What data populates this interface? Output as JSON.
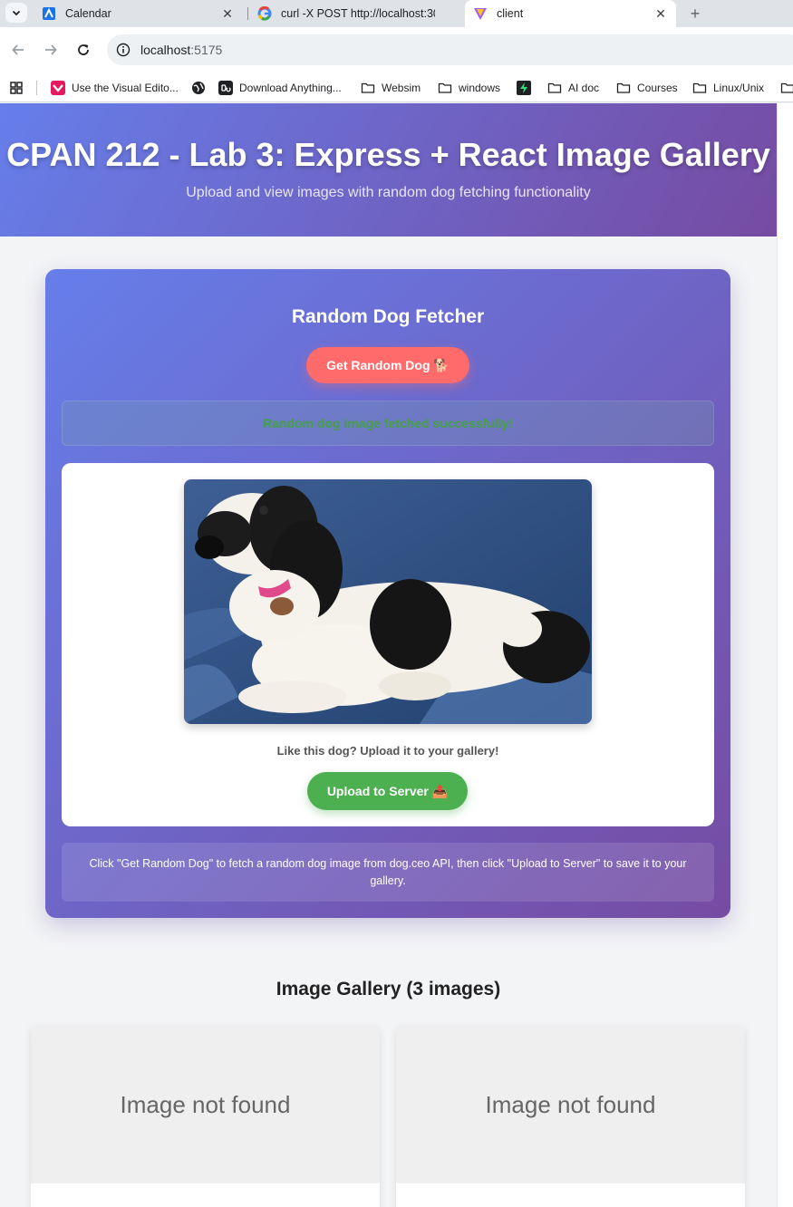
{
  "browser": {
    "tabs": [
      {
        "title": "Calendar",
        "favicon": "calendar-icon"
      },
      {
        "title": "curl -X POST http://localhost:30",
        "favicon": "google-icon"
      },
      {
        "title": "client",
        "favicon": "vite-icon"
      }
    ],
    "url_host": "localhost",
    "url_port": ":5175",
    "bookmarks": [
      "Use the Visual Edito...",
      "Download Anything...",
      "Websim",
      "windows",
      "AI doc",
      "Courses",
      "Linux/Unix"
    ]
  },
  "hero": {
    "title": "CPAN 212 - Lab 3: Express + React Image Gallery",
    "subtitle": "Upload and view images with random dog fetching functionality"
  },
  "fetcher": {
    "title": "Random Dog Fetcher",
    "get_button": "Get Random Dog 🐕",
    "success_message": "Random dog image fetched successfully!",
    "caption": "Like this dog? Upload it to your gallery!",
    "upload_button": "Upload to Server 📤",
    "hint": "Click \"Get Random Dog\" to fetch a random dog image from dog.ceo API, then click \"Upload to Server\" to save it to your gallery."
  },
  "gallery": {
    "title": "Image Gallery (3 images)",
    "cards": [
      {
        "placeholder": "Image not found"
      },
      {
        "placeholder": "Image not found"
      }
    ]
  },
  "colors": {
    "gradient_start": "#667eea",
    "gradient_end": "#764ba2",
    "dog_button": "#ff6b6b",
    "upload_button": "#4caf50",
    "success_text": "#43a047"
  }
}
